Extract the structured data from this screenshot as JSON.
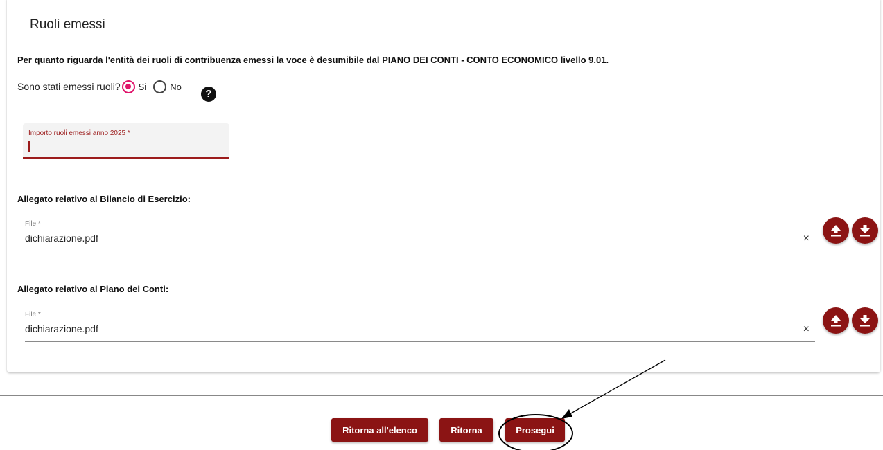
{
  "section": {
    "title": "Ruoli emessi",
    "description": "Per quanto riguarda l'entità dei ruoli di contribuenza emessi la voce è desumibile dal PIANO DEI CONTI - CONTO ECONOMICO livello 9.01."
  },
  "question": {
    "label": "Sono stati emessi ruoli?",
    "options": [
      {
        "label": "Si",
        "selected": true
      },
      {
        "label": "No",
        "selected": false
      }
    ],
    "help_icon": "question-circle-icon",
    "help_glyph": "?"
  },
  "importo_field": {
    "label": "Importo ruoli emessi anno 2025 *",
    "value": ""
  },
  "attachments": [
    {
      "heading": "Allegato relativo al Bilancio di Esercizio:",
      "field_label": "File *",
      "value": "dichiarazione.pdf",
      "clear_glyph": "×"
    },
    {
      "heading": "Allegato relativo al Piano dei Conti:",
      "field_label": "File *",
      "value": "dichiarazione.pdf",
      "clear_glyph": "×"
    }
  ],
  "footer_buttons": {
    "back_to_list": "Ritorna all'elenco",
    "back": "Ritorna",
    "next": "Prosegui"
  },
  "colors": {
    "accent": "#8b1414",
    "radio_selected": "#e0156b"
  },
  "icons": {
    "upload": "upload-icon",
    "download": "download-icon"
  }
}
